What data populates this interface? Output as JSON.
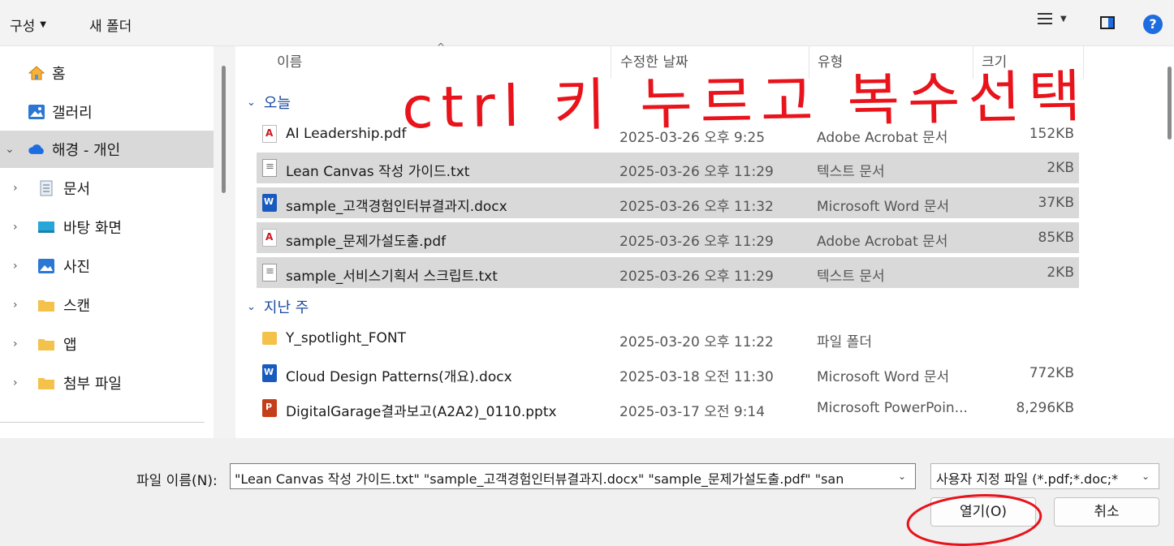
{
  "toolbar": {
    "organize_label": "구성",
    "new_folder_label": "새 폴더",
    "help_label": "?"
  },
  "sidebar": {
    "items": [
      {
        "label": "홈",
        "icon": "home-icon"
      },
      {
        "label": "갤러리",
        "icon": "gallery-icon"
      },
      {
        "label": "해경 - 개인",
        "icon": "onedrive-cloud-icon",
        "selected": true
      },
      {
        "label": "문서",
        "icon": "documents-icon"
      },
      {
        "label": "바탕 화면",
        "icon": "desktop-icon"
      },
      {
        "label": "사진",
        "icon": "pictures-icon"
      },
      {
        "label": "스캔",
        "icon": "folder-icon"
      },
      {
        "label": "앱",
        "icon": "folder-icon"
      },
      {
        "label": "첨부 파일",
        "icon": "folder-icon"
      }
    ]
  },
  "columns": {
    "name": "이름",
    "date": "수정한 날짜",
    "type": "유형",
    "size": "크기"
  },
  "groups": {
    "today": "오늘",
    "last_week": "지난 주"
  },
  "files": [
    {
      "name": "AI Leadership.pdf",
      "date": "2025-03-26 오후 9:25",
      "type": "Adobe Acrobat 문서",
      "size": "152KB",
      "icon": "pdf-icon",
      "selected": false
    },
    {
      "name": "Lean Canvas 작성 가이드.txt",
      "date": "2025-03-26 오후 11:29",
      "type": "텍스트 문서",
      "size": "2KB",
      "icon": "text-file-icon",
      "selected": true
    },
    {
      "name": "sample_고객경험인터뷰결과지.docx",
      "date": "2025-03-26 오후 11:32",
      "type": "Microsoft Word 문서",
      "size": "37KB",
      "icon": "word-icon",
      "selected": true
    },
    {
      "name": "sample_문제가설도출.pdf",
      "date": "2025-03-26 오후 11:29",
      "type": "Adobe Acrobat 문서",
      "size": "85KB",
      "icon": "pdf-icon",
      "selected": true
    },
    {
      "name": "sample_서비스기획서 스크립트.txt",
      "date": "2025-03-26 오후 11:29",
      "type": "텍스트 문서",
      "size": "2KB",
      "icon": "text-file-icon",
      "selected": true
    },
    {
      "name": "Y_spotlight_FONT",
      "date": "2025-03-20 오후 11:22",
      "type": "파일 폴더",
      "size": "",
      "icon": "folder-icon",
      "selected": false
    },
    {
      "name": "Cloud Design Patterns(개요).docx",
      "date": "2025-03-18 오전 11:30",
      "type": "Microsoft Word 문서",
      "size": "772KB",
      "icon": "word-icon",
      "selected": false
    },
    {
      "name": "DigitalGarage결과보고(A2A2)_0110.pptx",
      "date": "2025-03-17 오전 9:14",
      "type": "Microsoft PowerPoin...",
      "size": "8,296KB",
      "icon": "powerpoint-icon",
      "selected": false
    }
  ],
  "bottom": {
    "filename_label": "파일 이름(N):",
    "filename_value": "\"Lean Canvas 작성 가이드.txt\" \"sample_고객경험인터뷰결과지.docx\" \"sample_문제가설도출.pdf\" \"san",
    "filetype_value": "사용자 지정 파일 (*.pdf;*.doc;*",
    "open_label": "열기(O)",
    "cancel_label": "취소"
  },
  "annotation": {
    "text": "ctrl 키 누르고 복수선택",
    "color": "#e8131b"
  },
  "colors": {
    "accent": "#1d6ce0",
    "selection": "#d9d9d9",
    "annotation": "#e8131b"
  }
}
